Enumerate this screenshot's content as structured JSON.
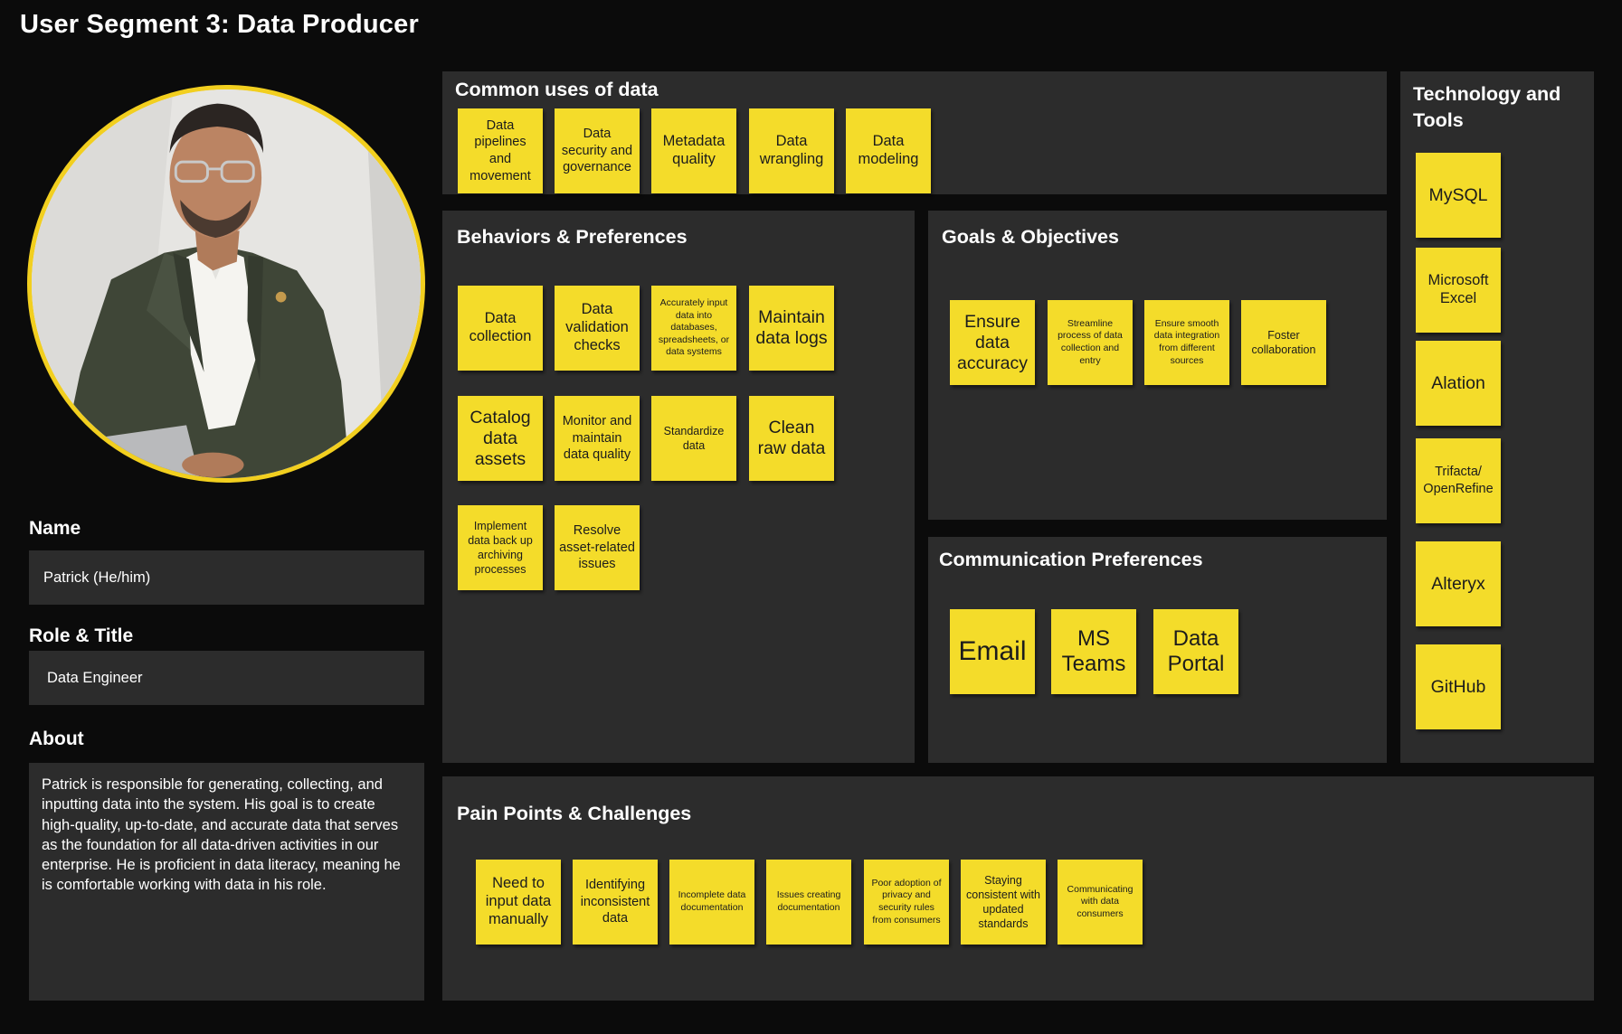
{
  "page_title": "User Segment 3: Data Producer",
  "profile": {
    "name_label": "Name",
    "name_value": "Patrick (He/him)",
    "role_label": "Role & Title",
    "role_value": "Data Engineer",
    "about_label": "About",
    "about_value": "Patrick is responsible for generating, collecting, and inputting data into the system. His goal is to create high-quality, up-to-date, and accurate data that serves as the foundation for all data-driven activities in our enterprise. He is proficient in data literacy, meaning he is comfortable working with data in his role.",
    "photo_ring_color": "#f2cf1f"
  },
  "common_uses": {
    "title": "Common uses of data",
    "notes": [
      "Data pipelines and movement",
      "Data security and governance",
      "Metadata quality",
      "Data wrangling",
      "Data modeling"
    ]
  },
  "behaviors": {
    "title": "Behaviors & Preferences",
    "notes": [
      "Data collection",
      "Data validation checks",
      "Accurately input data into databases, spreadsheets, or data systems",
      "Maintain data logs",
      "Catalog data assets",
      "Monitor and maintain data quality",
      "Standardize data",
      "Clean raw data",
      "Implement data back up archiving processes",
      "Resolve asset-related issues"
    ]
  },
  "goals": {
    "title": "Goals & Objectives",
    "notes": [
      "Ensure data accuracy",
      "Streamline process of data collection and entry",
      "Ensure smooth data integration from different sources",
      "Foster collaboration"
    ]
  },
  "communication": {
    "title": "Communication Preferences",
    "notes": [
      "Email",
      "MS Teams",
      "Data Portal"
    ]
  },
  "tools": {
    "title": "Technology and Tools",
    "notes": [
      "MySQL",
      "Microsoft Excel",
      "Alation",
      "Trifacta/ OpenRefine",
      "Alteryx",
      "GitHub"
    ]
  },
  "pain_points": {
    "title": "Pain Points & Challenges",
    "notes": [
      "Need to input data manually",
      "Identifying inconsistent data",
      "Incomplete data documentation",
      "Issues creating documentation",
      "Poor adoption of privacy and security rules from consumers",
      "Staying consistent with updated standards",
      "Communicating with data consumers"
    ]
  },
  "colors": {
    "background": "#0b0b0b",
    "panel": "#2c2c2c",
    "sticky_note": "#f4dc2a",
    "accent_ring": "#f2cf1f"
  }
}
